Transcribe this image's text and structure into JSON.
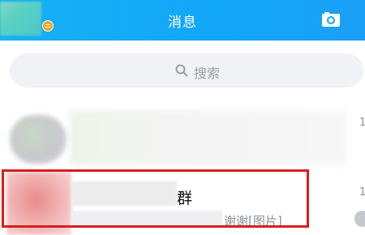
{
  "header": {
    "title": "消息",
    "left_icon": "avatar",
    "status_icon": "menu-dot-icon",
    "right_icon": "camera-icon",
    "color": "#12a6f8"
  },
  "search": {
    "placeholder": "搜索",
    "icon": "search-icon"
  },
  "conversations": [
    {
      "name": "",
      "preview": "",
      "time": "1"
    },
    {
      "name": "群",
      "preview": "谢谢[图片]",
      "time": "1"
    }
  ],
  "highlight_color": "#d81e1e"
}
